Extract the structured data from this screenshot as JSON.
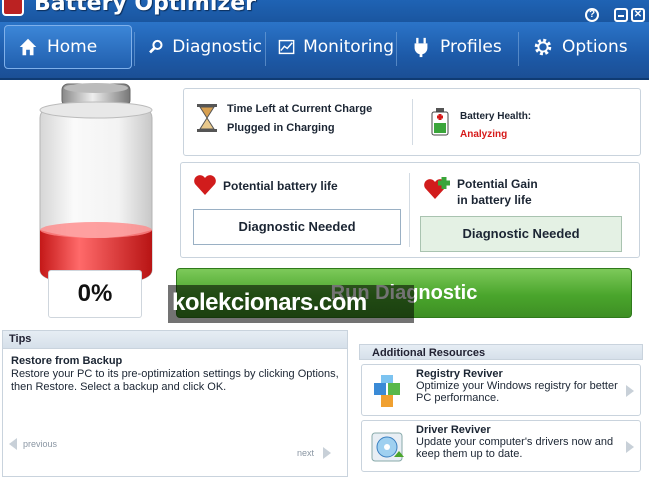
{
  "app": {
    "title": "Battery Optimizer"
  },
  "window": {
    "help_label": "?",
    "minimize_label": "",
    "close_label": "✕"
  },
  "nav": {
    "tabs": [
      {
        "label": "Home",
        "icon": "home-icon",
        "active": true
      },
      {
        "label": "Diagnostic",
        "icon": "magnifier-icon"
      },
      {
        "label": "Monitoring",
        "icon": "monitor-chart-icon"
      },
      {
        "label": "Profiles",
        "icon": "plug-icon"
      },
      {
        "label": "Options",
        "icon": "gear-icon"
      }
    ]
  },
  "battery": {
    "percent_label": "0%",
    "charge_fraction": 0.0,
    "fill_color": "#e52a2a"
  },
  "status": {
    "time_left_label": "Time Left at Current Charge",
    "plugged_label": "Plugged in Charging",
    "health_label": "Battery Health:",
    "health_value": "Analyzing",
    "health_color": "#d61a1a"
  },
  "potential": {
    "life_label": "Potential battery life",
    "life_value": "Diagnostic Needed",
    "gain_label": "Potential Gain",
    "gain_label2": "in battery life",
    "gain_value": "Diagnostic Needed"
  },
  "run_button": {
    "label": "Run Diagnostic"
  },
  "watermark": {
    "text": "kolekcionars.com"
  },
  "tips": {
    "header": "Tips",
    "title": "Restore from Backup",
    "body": "Restore your PC to its pre-optimization settings by clicking Options, then Restore. Select a backup and click OK.",
    "prev_label": "previous",
    "next_label": "next"
  },
  "resources": {
    "header": "Additional Resources",
    "items": [
      {
        "title": "Registry Reviver",
        "desc": "Optimize your Windows registry for better PC performance.",
        "icon": "registry-cube-icon"
      },
      {
        "title": "Driver Reviver",
        "desc": "Update your computer's drivers now and keep them up to date.",
        "icon": "driver-disc-icon"
      }
    ]
  },
  "colors": {
    "accent": "#1d5aa8",
    "run_green": "#4aa52c"
  }
}
